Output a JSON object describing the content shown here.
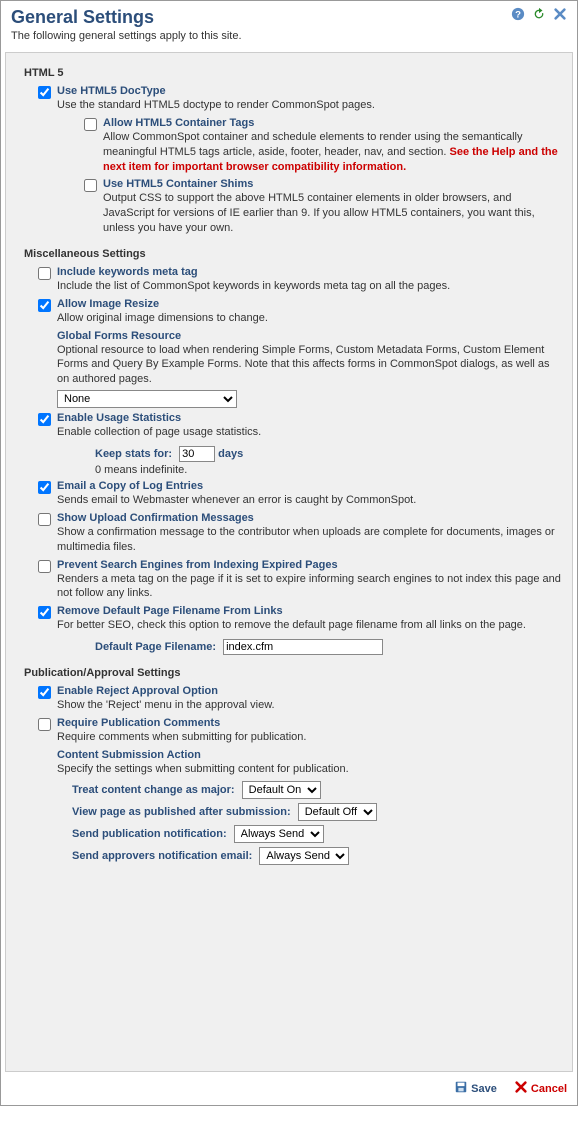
{
  "header": {
    "title": "General Settings",
    "subtitle": "The following general settings apply to this site."
  },
  "sections": {
    "html5": {
      "label": "HTML 5",
      "useDoctype": {
        "title": "Use HTML5 DocType",
        "desc": "Use the standard HTML5 doctype to render CommonSpot pages."
      },
      "allowContainer": {
        "title": "Allow HTML5 Container Tags",
        "desc1": "Allow CommonSpot container and schedule elements to render using the semantically meaningful HTML5 tags article, aside, footer, header, nav, and section. ",
        "warn": "See the Help and the next item for important browser compatibility information."
      },
      "shims": {
        "title": "Use HTML5 Container Shims",
        "desc": "Output CSS to support the above HTML5 container elements in older browsers, and JavaScript for versions of IE earlier than 9. If you allow HTML5 containers, you want this, unless you have your own."
      }
    },
    "misc": {
      "label": "Miscellaneous Settings",
      "keywords": {
        "title": "Include keywords meta tag",
        "desc": "Include the list of CommonSpot keywords in keywords meta tag on all the pages."
      },
      "imgResize": {
        "title": "Allow Image Resize",
        "desc": "Allow original image dimensions to change."
      },
      "globalForms": {
        "title": "Global Forms Resource",
        "desc": "Optional resource to load when rendering Simple Forms, Custom Metadata Forms, Custom Element Forms and Query By Example Forms. Note that this affects forms in CommonSpot dialogs, as well as on authored pages.",
        "selected": "None"
      },
      "usageStats": {
        "title": "Enable Usage Statistics",
        "desc": "Enable collection of page usage statistics.",
        "keepLabel": "Keep stats for:",
        "keepValue": "30",
        "keepUnit": "days",
        "note": "0 means indefinite."
      },
      "emailLog": {
        "title": "Email a Copy of Log Entries",
        "desc": "Sends email to Webmaster whenever an error is caught by CommonSpot."
      },
      "uploadConfirm": {
        "title": "Show Upload Confirmation Messages",
        "desc": "Show a confirmation message to the contributor when uploads are complete for documents, images or multimedia files."
      },
      "preventSearch": {
        "title": "Prevent Search Engines from Indexing Expired Pages",
        "desc": "Renders a meta tag on the page if it is set to expire informing search engines to not index this page and not follow any links."
      },
      "removeDefault": {
        "title": "Remove Default Page Filename From Links",
        "desc": "For better SEO, check this option to remove the default page filename from all links on the page.",
        "filenameLabel": "Default Page Filename:",
        "filenameValue": "index.cfm"
      }
    },
    "pub": {
      "label": "Publication/Approval Settings",
      "reject": {
        "title": "Enable Reject Approval Option",
        "desc": "Show the 'Reject' menu in the approval view."
      },
      "reqComments": {
        "title": "Require Publication Comments",
        "desc": "Require comments when submitting for publication."
      },
      "csa": {
        "title": "Content Submission Action",
        "desc": "Specify the settings when submitting content for publication.",
        "major": {
          "label": "Treat content change as major:",
          "value": "Default On"
        },
        "viewAfter": {
          "label": "View page as published after submission:",
          "value": "Default Off"
        },
        "pubNotif": {
          "label": "Send publication notification:",
          "value": "Always Send"
        },
        "apprNotif": {
          "label": "Send approvers notification email:",
          "value": "Always Send"
        }
      }
    }
  },
  "footer": {
    "save": "Save",
    "cancel": "Cancel"
  }
}
